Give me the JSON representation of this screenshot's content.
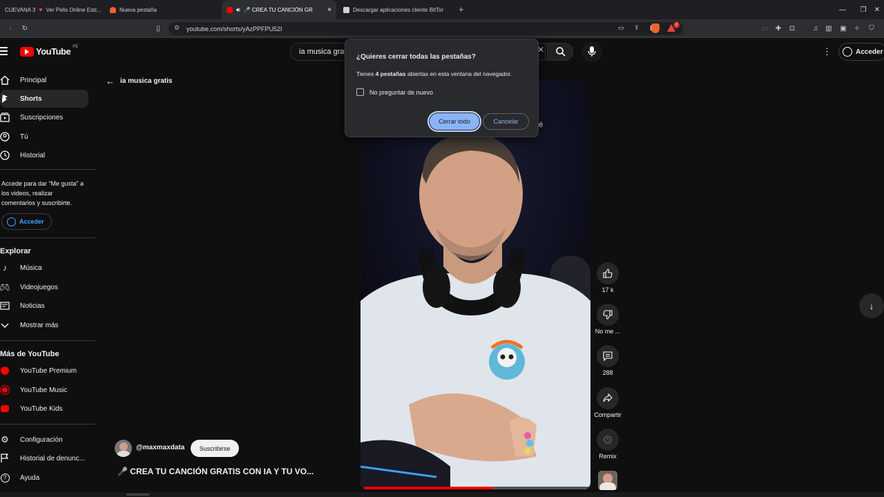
{
  "browser": {
    "tabs": [
      {
        "label": "CUEVANA 3",
        "color": "#1f1f23"
      },
      {
        "label": "Ver Pelis Online Estr...",
        "color": "#e8453c"
      },
      {
        "label": "Nueva pestaña",
        "color": "#f0642c"
      },
      {
        "label": "🎤 CREA TU CANCIÓN GRATI",
        "color": "#ff0000"
      },
      {
        "label": "Descargar aplicaciones cliente BitTor",
        "color": "#d0d0d0"
      }
    ],
    "url": "youtube.com/shorts/yAzPPFPU52I",
    "extension_badge": "2"
  },
  "youtube": {
    "logo_text": "YouTube",
    "country_code": "PE",
    "search_value": "ia musica grat",
    "signin_label": "Acceder"
  },
  "sidebar": {
    "items": [
      {
        "label": "Principal",
        "icon": "home-icon"
      },
      {
        "label": "Shorts",
        "icon": "shorts-icon"
      },
      {
        "label": "Suscripciones",
        "icon": "subscriptions-icon"
      },
      {
        "label": "Tú",
        "icon": "you-icon"
      },
      {
        "label": "Historial",
        "icon": "history-icon"
      }
    ],
    "signin_prompt": "Accede para dar “Me gusta” a los videos, realizar comentarios y suscribirte.",
    "signin_button": "Acceder",
    "explore_title": "Explorar",
    "explore": [
      {
        "label": "Música",
        "icon": "music-icon"
      },
      {
        "label": "Videojuegos",
        "icon": "gaming-icon"
      },
      {
        "label": "Noticias",
        "icon": "news-icon"
      },
      {
        "label": "Mostrar más",
        "icon": "chevron-down-icon"
      }
    ],
    "more_title": "Más de YouTube",
    "more": [
      {
        "label": "YouTube Premium",
        "icon": "youtube-premium-icon"
      },
      {
        "label": "YouTube Music",
        "icon": "youtube-music-icon"
      },
      {
        "label": "YouTube Kids",
        "icon": "youtube-kids-icon"
      }
    ],
    "settings": [
      {
        "label": "Configuración",
        "icon": "gear-icon"
      },
      {
        "label": "Historial de denunc...",
        "icon": "flag-icon"
      },
      {
        "label": "Ayuda",
        "icon": "help-icon"
      }
    ]
  },
  "shorts": {
    "back_label": "ia musica gratis",
    "channel": "@maxmaxdata",
    "subscribe_label": "Suscribirse",
    "title": "🎤 CREA TU CANCIÓN GRATIS CON IA Y TU VO...",
    "overlay_char": "é",
    "actions": {
      "likes": "17 k",
      "dislike": "No me ...",
      "comments": "288",
      "share": "Compartir",
      "remix": "Remix"
    }
  },
  "dialog": {
    "title": "¿Quieres cerrar todas las pestañas?",
    "message_pre": "Tienes ",
    "message_bold": "4 pestañas",
    "message_post": " abiertas en esta ventana del navegador.",
    "checkbox_label": "No preguntar de nuevo",
    "checkbox_checked": false,
    "confirm_label": "Cerrar todo",
    "cancel_label": "Cancelar"
  },
  "colors": {
    "accent": "#8ab4f8",
    "brand": "#ff0000"
  }
}
